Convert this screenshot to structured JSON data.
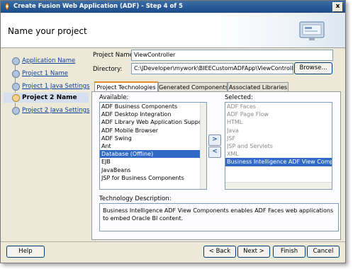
{
  "window": {
    "title": "Create Fusion Web Application (ADF) - Step 4 of 5",
    "close_label": "x"
  },
  "banner": {
    "title": "Name your project"
  },
  "nav": {
    "items": [
      {
        "label": "Application Name"
      },
      {
        "label": "Project 1 Name"
      },
      {
        "label": "Project 1 Java Settings"
      },
      {
        "label": "Project 2 Name"
      },
      {
        "label": "Project 2 Java Settings"
      }
    ],
    "current_index": 3
  },
  "form": {
    "project_name_label": "Project Name:",
    "project_name_value": "ViewController",
    "directory_label": "Directory:",
    "directory_value": "C:\\JDeveloper\\mywork\\BIEECustomADFApp\\ViewController",
    "browse_label": "Browse..."
  },
  "tabs": [
    {
      "label": "Project Technologies",
      "active": true
    },
    {
      "label": "Generated Components",
      "active": false
    },
    {
      "label": "Associated Libraries",
      "active": false
    }
  ],
  "available": {
    "label": "Available:",
    "items": [
      "ADF Business Components",
      "ADF Desktop Integration",
      "ADF Library Web Application Support",
      "ADF Mobile Browser",
      "ADF Swing",
      "Ant",
      "Database (Offline)",
      "EJB",
      "JavaBeans",
      "JSP for Business Components"
    ],
    "selected_index": 6
  },
  "selected": {
    "label": "Selected:",
    "items": [
      "ADF Faces",
      "ADF Page Flow",
      "HTML",
      "Java",
      "JSF",
      "JSP and Servlets",
      "XML",
      "Business Intelligence ADF View Componen"
    ],
    "selected_index": 7
  },
  "move_right_label": ">",
  "move_left_label": "<",
  "technology_description": {
    "label": "Technology Description:",
    "text": "Business Intelligence ADF View Components enables ADF Faces web applications to embed Oracle BI content."
  },
  "footer": {
    "help_label": "Help",
    "back_label": "< Back",
    "next_label": "Next >",
    "finish_label": "Finish",
    "cancel_label": "Cancel"
  },
  "colors": {
    "titlebar": "#1d4b8a",
    "selection": "#316ac5",
    "link": "#0b3f9a",
    "active_tab_accent": "#e68b2c"
  }
}
